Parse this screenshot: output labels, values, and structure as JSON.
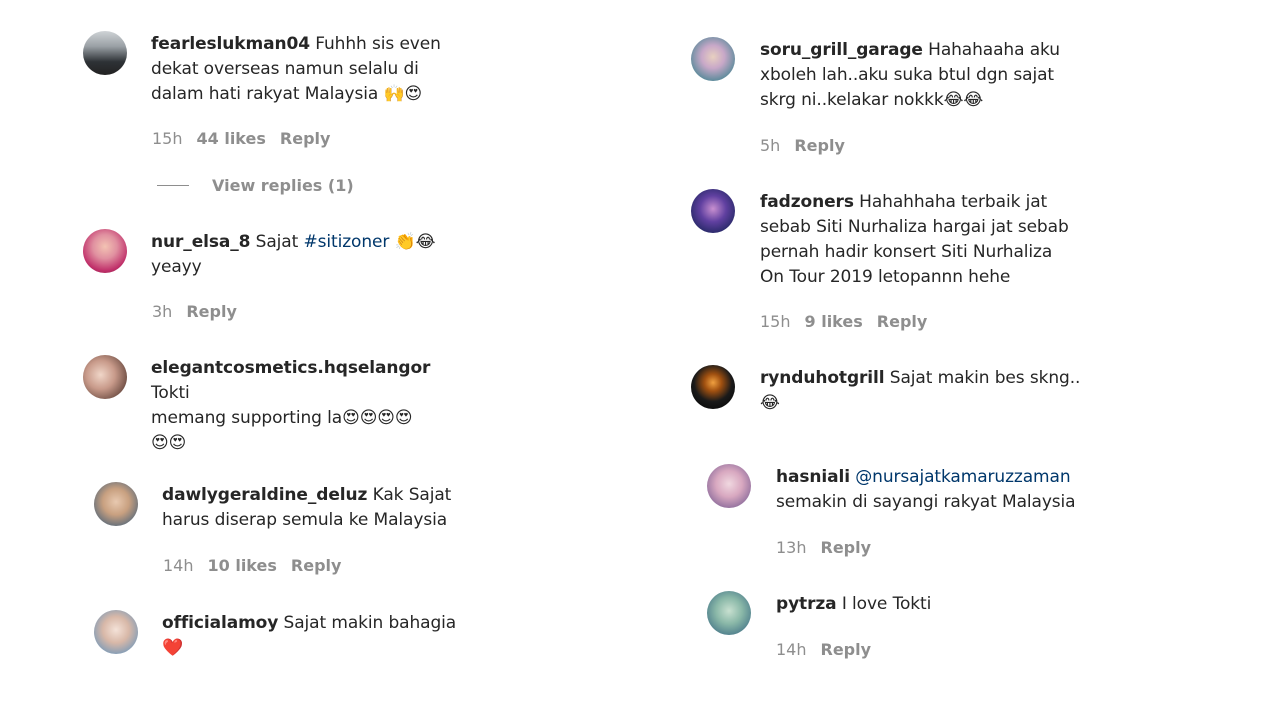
{
  "left": {
    "c1": {
      "user": "fearleslukman04",
      "text": " Fuhhh sis even",
      "line2": "dekat overseas namun selalu di",
      "line3": "dalam hati rakyat Malaysia 🙌😍",
      "time": "15h",
      "likes": "44 likes",
      "reply": "Reply",
      "view_replies": "View replies (1)"
    },
    "c2": {
      "user": "nur_elsa_8",
      "text": " Sajat ",
      "hashtag": "#sitizoner",
      "emoji": " 👏😂",
      "line2": "yeayy",
      "time": "3h",
      "reply": "Reply"
    },
    "c3": {
      "user": "elegantcosmetics.hqselangor",
      "text": " Tokti",
      "line2": "memang supporting la😍😍😍😍",
      "line3": "😍😍"
    },
    "c4": {
      "user": "dawlygeraldine_deluz",
      "text": " Kak Sajat",
      "line2": "harus diserap semula ke Malaysia",
      "time": "14h",
      "likes": "10 likes",
      "reply": "Reply"
    },
    "c5": {
      "user": "officialamoy",
      "text": " Sajat makin bahagia",
      "line2": "❤️"
    }
  },
  "right": {
    "c1": {
      "user": "soru_grill_garage",
      "text": " Hahahaaha aku",
      "line2": "xboleh lah..aku suka btul dgn sajat",
      "line3": "skrg ni..kelakar nokkk😂😂",
      "time": "5h",
      "reply": "Reply"
    },
    "c2": {
      "user": "fadzoners",
      "text": " Hahahhaha terbaik jat",
      "line2": "sebab Siti Nurhaliza hargai jat sebab",
      "line3": "pernah hadir konsert Siti Nurhaliza",
      "line4": "On Tour 2019 letopannn hehe",
      "time": "15h",
      "likes": "9 likes",
      "reply": "Reply"
    },
    "c3": {
      "user": "rynduhotgrill",
      "text": " Sajat makin bes skng..",
      "line2": "😂"
    },
    "c4": {
      "user": "hasniali",
      "mention": " @nursajatkamaruzzaman",
      "line2": "semakin di sayangi rakyat Malaysia",
      "time": "13h",
      "reply": "Reply"
    },
    "c5": {
      "user": "pytrza",
      "text": " I love Tokti",
      "time": "14h",
      "reply": "Reply"
    }
  }
}
